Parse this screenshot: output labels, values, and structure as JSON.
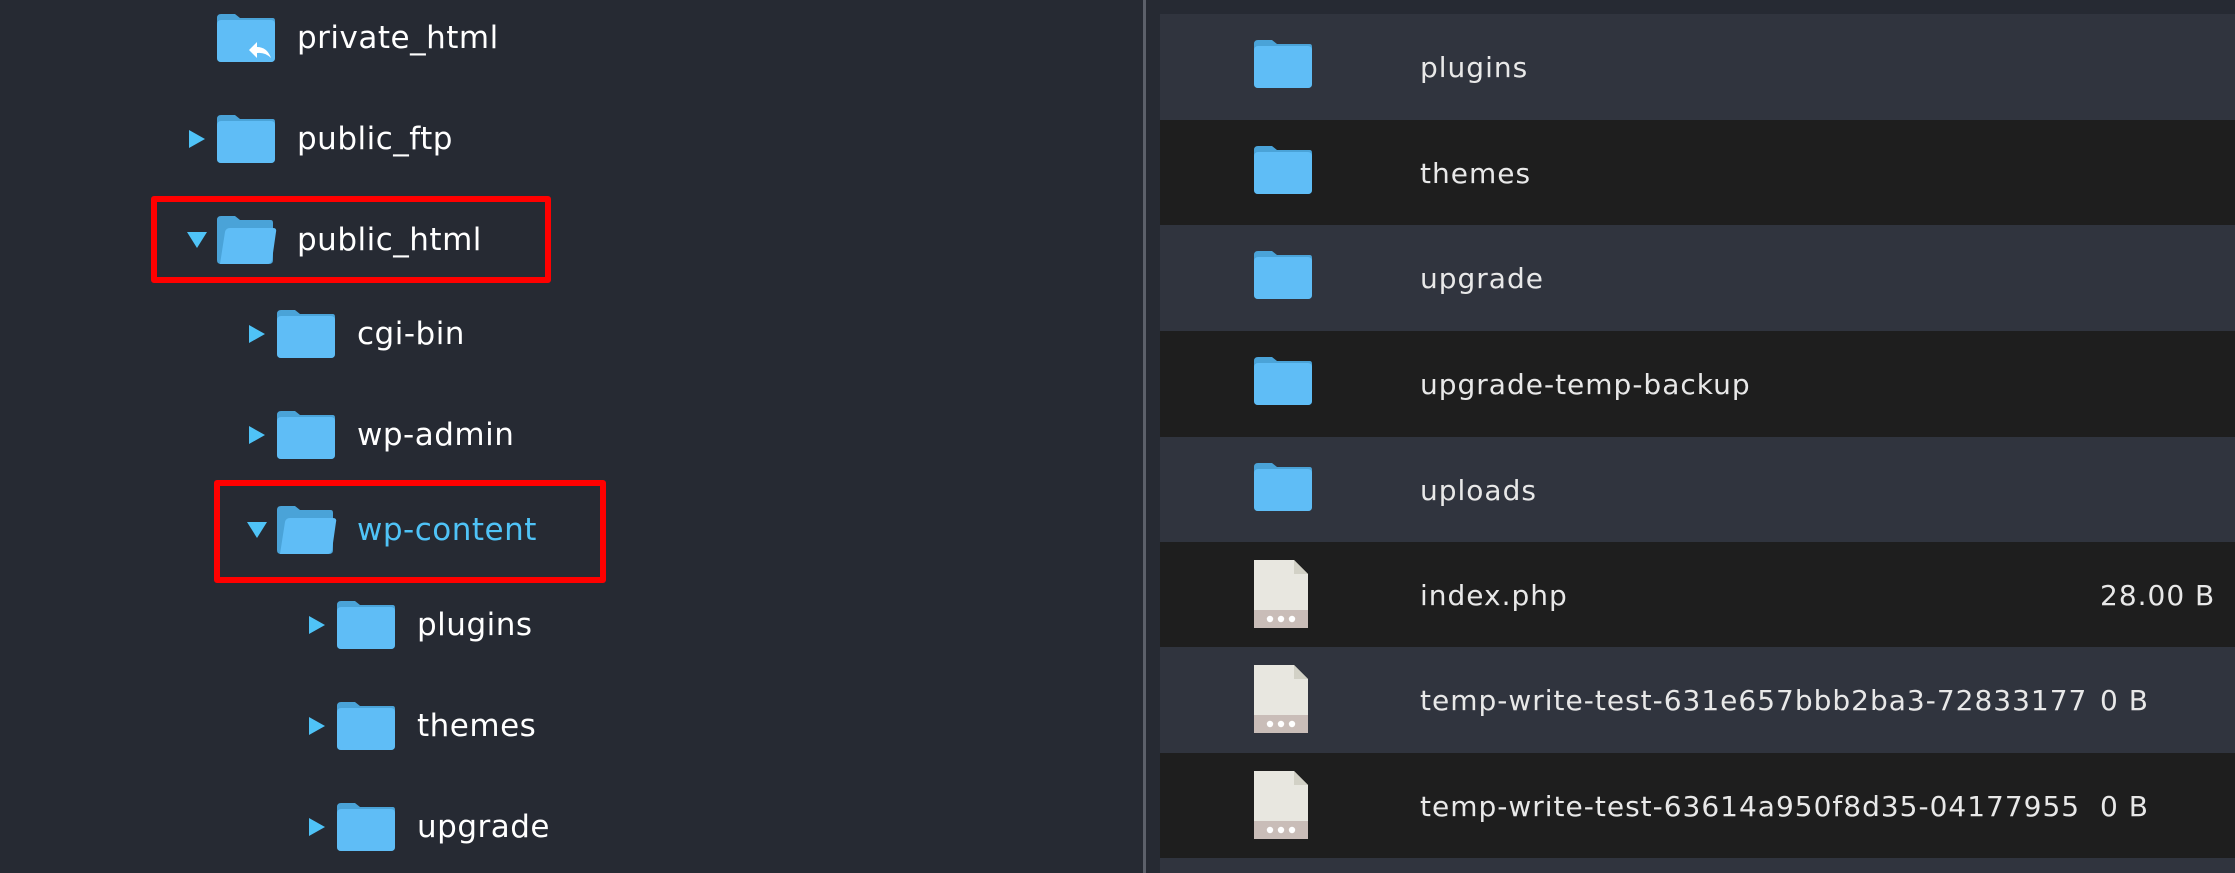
{
  "tree": {
    "nodes": [
      {
        "label": "private_html",
        "caret": "none",
        "icon": "folder-link-icon",
        "active": false,
        "highlighted": false
      },
      {
        "label": "public_ftp",
        "caret": "collapsed",
        "icon": "folder-icon",
        "active": false,
        "highlighted": false
      },
      {
        "label": "public_html",
        "caret": "expanded",
        "icon": "folder-open-icon",
        "active": false,
        "highlighted": true
      },
      {
        "label": "cgi-bin",
        "caret": "collapsed",
        "icon": "folder-icon",
        "active": false,
        "highlighted": false
      },
      {
        "label": "wp-admin",
        "caret": "collapsed",
        "icon": "folder-icon",
        "active": false,
        "highlighted": false
      },
      {
        "label": "wp-content",
        "caret": "expanded",
        "icon": "folder-open-icon",
        "active": true,
        "highlighted": true
      },
      {
        "label": "plugins",
        "caret": "collapsed",
        "icon": "folder-icon",
        "active": false,
        "highlighted": false
      },
      {
        "label": "themes",
        "caret": "collapsed",
        "icon": "folder-icon",
        "active": false,
        "highlighted": false
      },
      {
        "label": "upgrade",
        "caret": "collapsed",
        "icon": "folder-icon",
        "active": false,
        "highlighted": false
      }
    ]
  },
  "files": {
    "rows": [
      {
        "name": "plugins",
        "type": "folder",
        "size": ""
      },
      {
        "name": "themes",
        "type": "folder",
        "size": ""
      },
      {
        "name": "upgrade",
        "type": "folder",
        "size": ""
      },
      {
        "name": "upgrade-temp-backup",
        "type": "folder",
        "size": ""
      },
      {
        "name": "uploads",
        "type": "folder",
        "size": ""
      },
      {
        "name": "index.php",
        "type": "file",
        "size": "28.00 B"
      },
      {
        "name": "temp-write-test-631e657bbb2ba3-72833177",
        "type": "file",
        "size": "0 B"
      },
      {
        "name": "temp-write-test-63614a950f8d35-04177955",
        "type": "file",
        "size": "0 B"
      }
    ]
  },
  "colors": {
    "folder": "#5fbdf6",
    "folder_tab": "#4aa3d8",
    "accent": "#4fc3f7",
    "highlight": "#ff0000"
  }
}
